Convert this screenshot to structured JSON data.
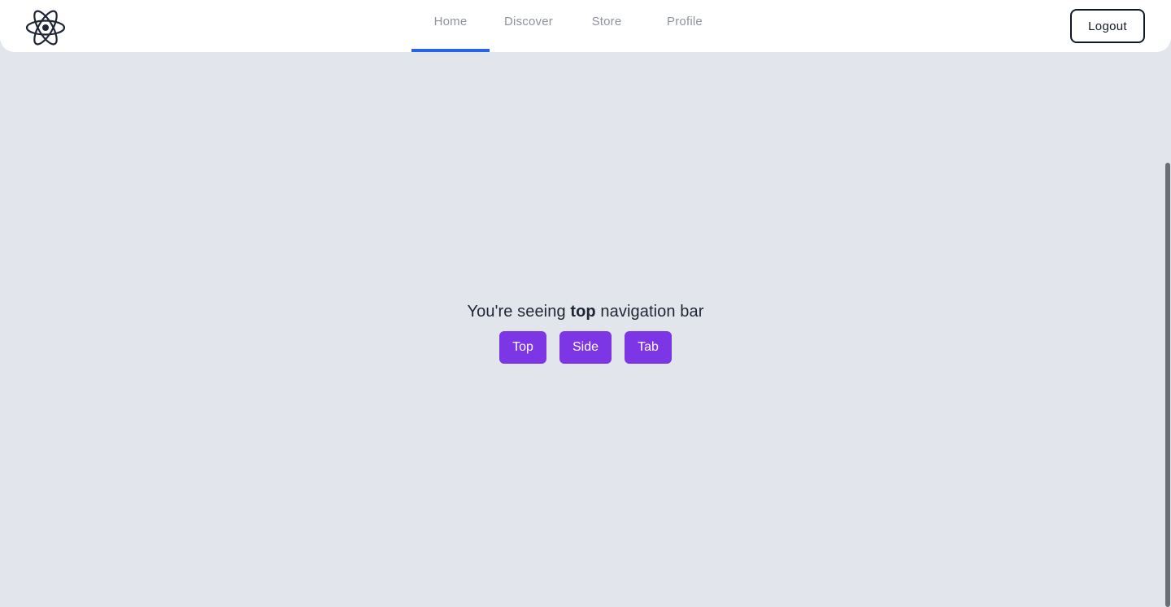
{
  "header": {
    "nav": [
      "Home",
      "Discover",
      "Store",
      "Profile"
    ],
    "active_tab": "Home",
    "logout_label": "Logout",
    "logo_icon": "react-atom-icon"
  },
  "main": {
    "message_prefix": "You're seeing ",
    "message_bold": "top",
    "message_suffix": " navigation bar",
    "buttons": [
      "Top",
      "Side",
      "Tab"
    ]
  },
  "colors": {
    "active_underline": "#2664e8",
    "button_bg": "#7c36e6",
    "page_bg": "#e2e6ec"
  }
}
